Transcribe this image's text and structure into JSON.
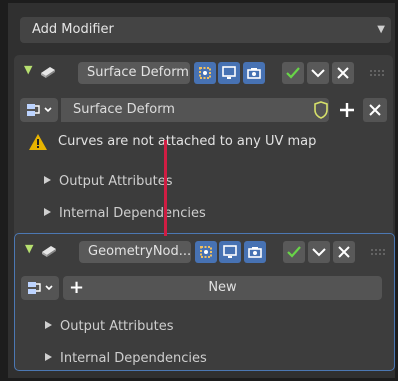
{
  "add_modifier": {
    "label": "Add Modifier"
  },
  "modifier1": {
    "name": "Surface Deform",
    "node_group": "Surface Deform",
    "warning": "Curves are not attached to any UV map",
    "sections": [
      "Output Attributes",
      "Internal Dependencies"
    ]
  },
  "modifier2": {
    "name": "GeometryNod...",
    "new_label": "New",
    "sections": [
      "Output Attributes",
      "Internal Dependencies"
    ]
  },
  "colors": {
    "accent_blue": "#4772b3",
    "drop_line": "#d01d43",
    "check_green": "#68d448",
    "warning_yellow": "#e8b400"
  }
}
